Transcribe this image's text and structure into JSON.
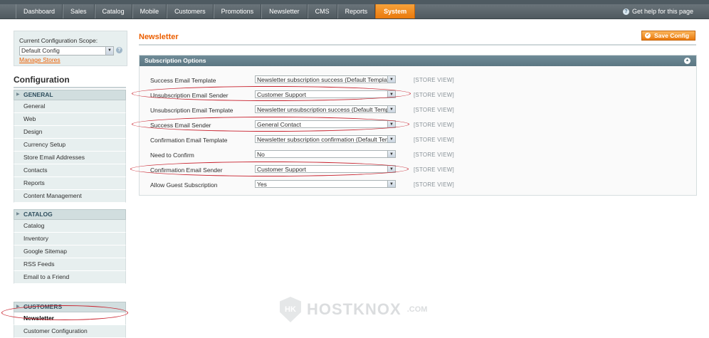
{
  "nav": {
    "items": [
      "Dashboard",
      "Sales",
      "Catalog",
      "Mobile",
      "Customers",
      "Promotions",
      "Newsletter",
      "CMS",
      "Reports",
      "System"
    ],
    "active": "System",
    "help": "Get help for this page"
  },
  "sidebar": {
    "scope_label": "Current Configuration Scope:",
    "scope_value": "Default Config",
    "manage_stores": "Manage Stores",
    "title": "Configuration",
    "groups": [
      {
        "name": "GENERAL",
        "items": [
          "General",
          "Web",
          "Design",
          "Currency Setup",
          "Store Email Addresses",
          "Contacts",
          "Reports",
          "Content Management"
        ]
      },
      {
        "name": "CATALOG",
        "items": [
          "Catalog",
          "Inventory",
          "Google Sitemap",
          "RSS Feeds",
          "Email to a Friend"
        ]
      },
      {
        "name": "CUSTOMERS",
        "items": [
          "Newsletter",
          "Customer Configuration"
        ]
      }
    ],
    "active_item": "Newsletter"
  },
  "main": {
    "title": "Newsletter",
    "save_label": "Save Config",
    "section_title": "Subscription Options",
    "rows": [
      {
        "label": "Success Email Template",
        "value": "Newsletter subscription success (Default Template",
        "scope": "[STORE VIEW]"
      },
      {
        "label": "Unsubscription Email Sender",
        "value": "Customer Support",
        "scope": "[STORE VIEW]"
      },
      {
        "label": "Unsubscription Email Template",
        "value": "Newsletter unsubscription success (Default Templ",
        "scope": "[STORE VIEW]"
      },
      {
        "label": "Success Email Sender",
        "value": "General Contact",
        "scope": "[STORE VIEW]"
      },
      {
        "label": "Confirmation Email Template",
        "value": "Newsletter subscription confirmation (Default Tem",
        "scope": "[STORE VIEW]"
      },
      {
        "label": "Need to Confirm",
        "value": "No",
        "scope": "[STORE VIEW]"
      },
      {
        "label": "Confirmation Email Sender",
        "value": "Customer Support",
        "scope": "[STORE VIEW]"
      },
      {
        "label": "Allow Guest Subscription",
        "value": "Yes",
        "scope": "[STORE VIEW]"
      }
    ]
  },
  "watermark": {
    "text": "HOSTKNOX",
    "suffix": ".COM",
    "logo": "HK"
  },
  "colors": {
    "accent": "#eb5e00",
    "nav": "#566066",
    "section_header": "#6a8591",
    "annotation": "#c8202c"
  }
}
